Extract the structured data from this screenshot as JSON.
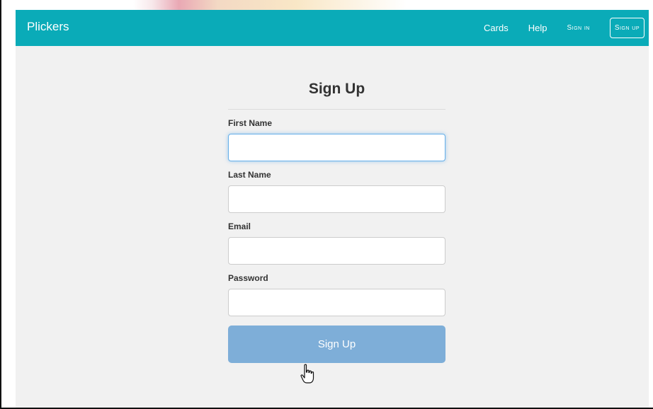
{
  "navbar": {
    "brand": "Plickers",
    "links": {
      "cards": "Cards",
      "help": "Help",
      "sign_in": "Sign in",
      "sign_up": "Sign up"
    },
    "color": "#0aabb8"
  },
  "form": {
    "title": "Sign Up",
    "fields": {
      "first_name": {
        "label": "First Name",
        "value": ""
      },
      "last_name": {
        "label": "Last Name",
        "value": ""
      },
      "email": {
        "label": "Email",
        "value": ""
      },
      "password": {
        "label": "Password",
        "value": ""
      }
    },
    "submit_label": "Sign Up",
    "submit_color": "#7eaed8"
  },
  "icons": {
    "cursor": "hand-pointer-icon"
  }
}
